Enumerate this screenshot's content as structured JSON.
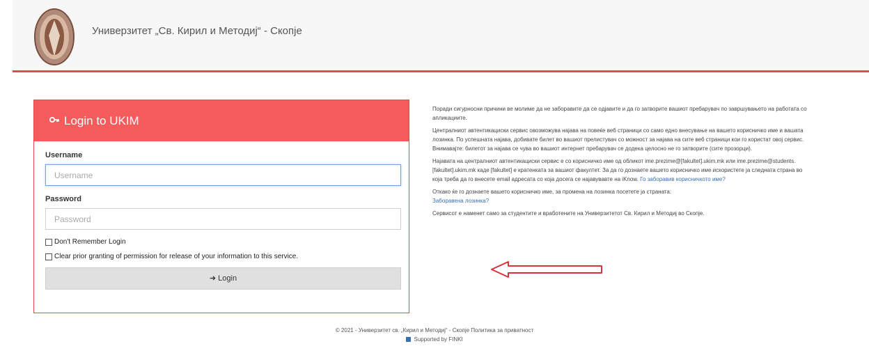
{
  "header": {
    "university_name": "Универзитет „Св. Кирил и Методиј“ - Скопје"
  },
  "login": {
    "title": "Login to UKIM",
    "username_label": "Username",
    "username_placeholder": "Username",
    "password_label": "Password",
    "password_placeholder": "Password",
    "dont_remember_label": "Don't Remember Login",
    "clear_permission_label": "Clear prior granting of permission for release of your information to this service.",
    "login_button": "Login"
  },
  "info": {
    "p1": "Поради сигурносни причини ве молиме да не заборавите да се одјавите и да го затворите вашиот пребарувач по завршувањето на работата со апликациите.",
    "p2": "Централниот автентикациски сервис овозможува најава на повеќе веб страници со само едно внесување на вашето корисничко име и вашата лозинка. По успешната најава, добивате билет во вашиот прелистувач со можност за најава на сите веб страници кои го користат овој сервис. Внимавајте: билетот за најава се чува во вашиот интернет пребарувач се додека целосно не го затворите (сите прозорци).",
    "p3": "Најавата на централниот автентикациски сервис е со корисничко име од обликот ime.prezime@[fakultet].ukim.mk или ime.prezime@students.[fakultet].ukim.mk каде [fakultet] е кратенката за вашиот факултет. За да го дознаете вашето корисничко име искористете ја следната страна во која треба да го внесете email адресата со која досега се најавувавте на iKnow.",
    "p3_link": "Го заборавив корисничкото име?",
    "p4": "Откако ќе го дознаете вашето корисничко име, за промена на лозинка посетете ја страната:",
    "p4_link": "Заборавена лозинка?",
    "p5": "Сервисот е наменет само за студентите и вработените на Универзитетот Св. Кирил и Методиј во Скопје."
  },
  "footer": {
    "copyright": "© 2021 - Универзитет св. „Кирил и Методиј“ - Скопје",
    "privacy_link": "Политика за приватност",
    "supported": "Supported by FINKI"
  }
}
